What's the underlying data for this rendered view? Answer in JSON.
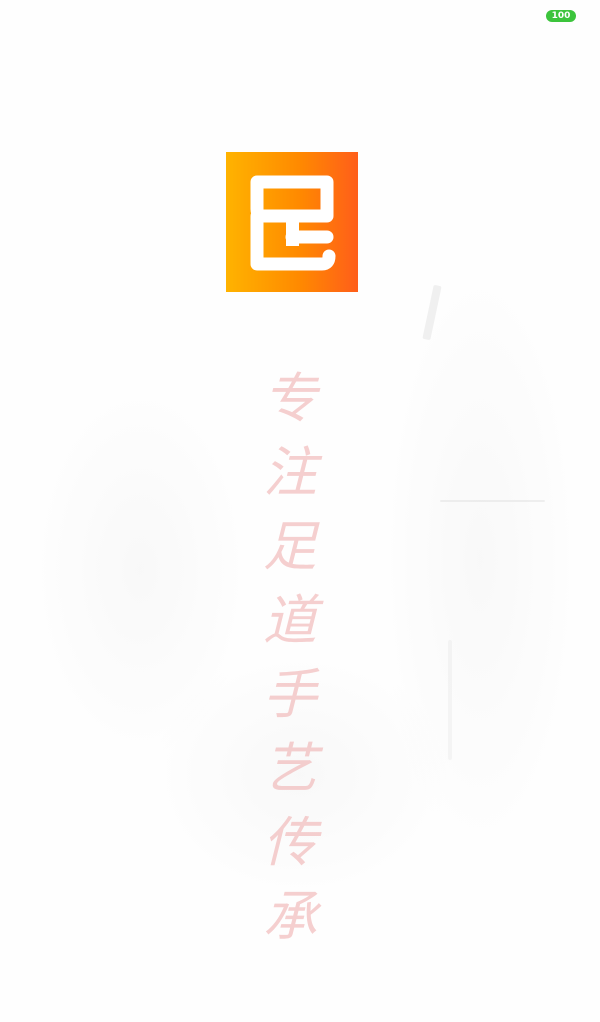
{
  "status_bar": {
    "battery_level": "100",
    "battery_color": "#3cc43c"
  },
  "logo": {
    "icon": "app-logo-icon",
    "gradient": [
      "#ffb300",
      "#ff8a00",
      "#ff5e1a"
    ]
  },
  "slogan": {
    "chars": [
      "专",
      "注",
      "足",
      "道",
      "手",
      "艺",
      "传",
      "承"
    ],
    "color": "#ec9696"
  }
}
